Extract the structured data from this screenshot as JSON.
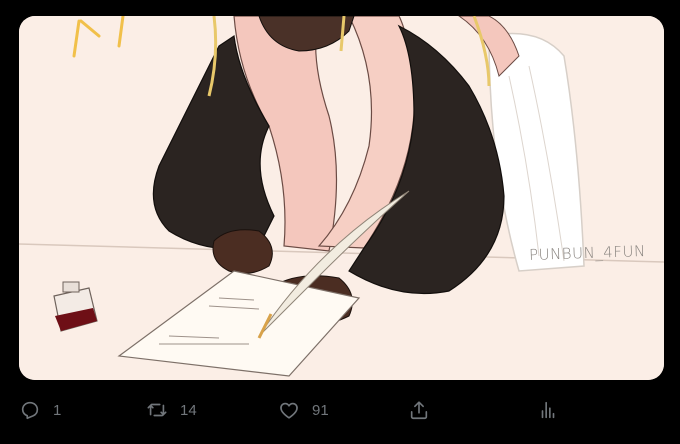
{
  "media": {
    "watermark": "PUNBUN_4FUN"
  },
  "actions": {
    "reply_count": "1",
    "retweet_count": "14",
    "like_count": "91"
  },
  "icons": {
    "reply": "reply-icon",
    "retweet": "retweet-icon",
    "like": "heart-icon",
    "share": "share-icon",
    "analytics": "analytics-icon"
  },
  "colors": {
    "background": "#000000",
    "icon": "#71767b",
    "paper": "#fbeee6"
  }
}
